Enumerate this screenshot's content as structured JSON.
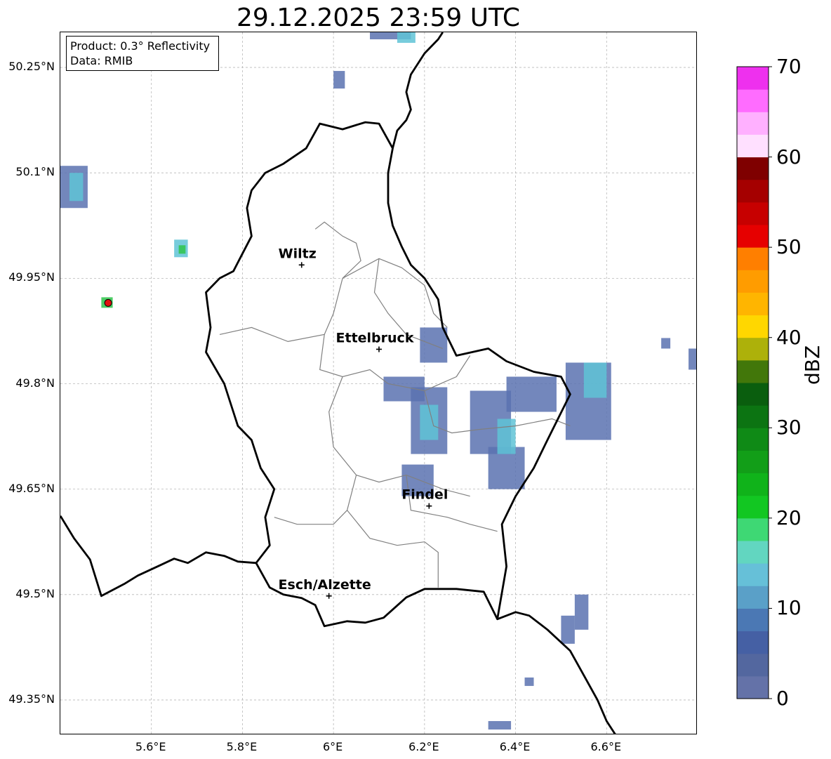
{
  "title": "29.12.2025 23:59 UTC",
  "info_box": {
    "product_line": "Product: 0.3° Reflectivity",
    "data_line": "Data: RMIB"
  },
  "map": {
    "lon_range": [
      5.4,
      6.8
    ],
    "lat_range": [
      49.3,
      50.3
    ],
    "lat_ticks": [
      {
        "value": 50.25,
        "label": "50.25°N"
      },
      {
        "value": 50.1,
        "label": "50.1°N"
      },
      {
        "value": 49.95,
        "label": "49.95°N"
      },
      {
        "value": 49.8,
        "label": "49.8°N"
      },
      {
        "value": 49.65,
        "label": "49.65°N"
      },
      {
        "value": 49.5,
        "label": "49.5°N"
      },
      {
        "value": 49.35,
        "label": "49.35°N"
      }
    ],
    "lon_ticks": [
      {
        "value": 5.6,
        "label": "5.6°E"
      },
      {
        "value": 5.8,
        "label": "5.8°E"
      },
      {
        "value": 6.0,
        "label": "6°E"
      },
      {
        "value": 6.2,
        "label": "6.2°E"
      },
      {
        "value": 6.4,
        "label": "6.4°E"
      },
      {
        "value": 6.6,
        "label": "6.6°E"
      }
    ],
    "cities": [
      {
        "name": "Wiltz",
        "lon": 5.93,
        "lat": 49.969
      },
      {
        "name": "Ettelbruck",
        "lon": 6.1,
        "lat": 49.849
      },
      {
        "name": "Findel",
        "lon": 6.21,
        "lat": 49.626
      },
      {
        "name": "Esch/Alzette",
        "lon": 5.99,
        "lat": 49.498
      }
    ],
    "border": [
      [
        5.4,
        49.612
      ],
      [
        5.43,
        49.58
      ],
      [
        5.465,
        49.55
      ],
      [
        5.49,
        49.498
      ],
      [
        5.54,
        49.515
      ],
      [
        5.57,
        49.527
      ],
      [
        5.62,
        49.542
      ],
      [
        5.65,
        49.551
      ],
      [
        5.68,
        49.545
      ],
      [
        5.72,
        49.56
      ],
      [
        5.76,
        49.555
      ],
      [
        5.79,
        49.547
      ],
      [
        5.83,
        49.545
      ],
      [
        5.86,
        49.51
      ],
      [
        5.89,
        49.5
      ],
      [
        5.93,
        49.495
      ],
      [
        5.96,
        49.485
      ],
      [
        5.98,
        49.455
      ],
      [
        6.03,
        49.462
      ],
      [
        6.07,
        49.46
      ],
      [
        6.11,
        49.467
      ],
      [
        6.16,
        49.496
      ],
      [
        6.2,
        49.508
      ],
      [
        6.27,
        49.508
      ],
      [
        6.33,
        49.504
      ],
      [
        6.36,
        49.465
      ],
      [
        6.4,
        49.475
      ],
      [
        6.43,
        49.47
      ],
      [
        6.47,
        49.45
      ],
      [
        6.52,
        49.42
      ],
      [
        6.55,
        49.385
      ],
      [
        6.58,
        49.35
      ],
      [
        6.6,
        49.32
      ],
      [
        6.62,
        49.3
      ]
    ],
    "border_east": [
      [
        6.36,
        49.465
      ],
      [
        6.38,
        49.54
      ],
      [
        6.37,
        49.6
      ],
      [
        6.4,
        49.64
      ],
      [
        6.44,
        49.68
      ],
      [
        6.47,
        49.72
      ],
      [
        6.52,
        49.785
      ],
      [
        6.5,
        49.81
      ],
      [
        6.44,
        49.817
      ],
      [
        6.38,
        49.832
      ],
      [
        6.34,
        49.85
      ],
      [
        6.27,
        49.84
      ],
      [
        6.24,
        49.88
      ],
      [
        6.23,
        49.92
      ],
      [
        6.2,
        49.95
      ],
      [
        6.17,
        49.969
      ],
      [
        6.15,
        49.995
      ],
      [
        6.13,
        50.025
      ],
      [
        6.12,
        50.057
      ],
      [
        6.12,
        50.1
      ],
      [
        6.13,
        50.135
      ],
      [
        6.14,
        50.16
      ],
      [
        6.16,
        50.175
      ],
      [
        6.17,
        50.19
      ],
      [
        6.16,
        50.215
      ],
      [
        6.17,
        50.24
      ],
      [
        6.2,
        50.27
      ],
      [
        6.23,
        50.29
      ],
      [
        6.24,
        50.3
      ]
    ],
    "border_north": [
      [
        6.13,
        50.135
      ],
      [
        6.1,
        50.17
      ],
      [
        6.07,
        50.172
      ],
      [
        6.02,
        50.162
      ],
      [
        5.97,
        50.17
      ],
      [
        5.94,
        50.135
      ],
      [
        5.89,
        50.113
      ],
      [
        5.85,
        50.1
      ],
      [
        5.82,
        50.075
      ],
      [
        5.81,
        50.05
      ],
      [
        5.82,
        50.01
      ],
      [
        5.8,
        49.985
      ],
      [
        5.78,
        49.96
      ],
      [
        5.75,
        49.95
      ],
      [
        5.72,
        49.93
      ],
      [
        5.73,
        49.88
      ],
      [
        5.72,
        49.845
      ],
      [
        5.76,
        49.8
      ],
      [
        5.79,
        49.74
      ],
      [
        5.82,
        49.72
      ],
      [
        5.84,
        49.68
      ],
      [
        5.87,
        49.65
      ],
      [
        5.85,
        49.61
      ],
      [
        5.86,
        49.57
      ],
      [
        5.83,
        49.545
      ]
    ],
    "cantons": [
      [
        [
          5.96,
          50.02
        ],
        [
          5.98,
          50.03
        ],
        [
          6.02,
          50.01
        ],
        [
          6.05,
          50.0
        ],
        [
          6.06,
          49.975
        ],
        [
          6.02,
          49.95
        ],
        [
          6.0,
          49.9
        ],
        [
          5.98,
          49.87
        ],
        [
          5.9,
          49.86
        ],
        [
          5.82,
          49.88
        ],
        [
          5.75,
          49.87
        ]
      ],
      [
        [
          6.02,
          49.95
        ],
        [
          6.1,
          49.978
        ],
        [
          6.15,
          49.965
        ],
        [
          6.2,
          49.94
        ],
        [
          6.22,
          49.9
        ],
        [
          6.25,
          49.88
        ]
      ],
      [
        [
          6.1,
          49.978
        ],
        [
          6.09,
          49.93
        ],
        [
          6.12,
          49.9
        ],
        [
          6.16,
          49.87
        ],
        [
          6.2,
          49.86
        ],
        [
          6.24,
          49.85
        ]
      ],
      [
        [
          5.98,
          49.87
        ],
        [
          5.97,
          49.82
        ],
        [
          6.02,
          49.81
        ],
        [
          6.08,
          49.82
        ],
        [
          6.12,
          49.8
        ],
        [
          6.2,
          49.79
        ],
        [
          6.27,
          49.81
        ],
        [
          6.3,
          49.84
        ]
      ],
      [
        [
          6.02,
          49.81
        ],
        [
          5.99,
          49.76
        ],
        [
          6.0,
          49.71
        ],
        [
          6.05,
          49.67
        ],
        [
          6.1,
          49.66
        ],
        [
          6.16,
          49.67
        ],
        [
          6.24,
          49.65
        ],
        [
          6.3,
          49.64
        ]
      ],
      [
        [
          6.2,
          49.79
        ],
        [
          6.22,
          49.74
        ],
        [
          6.26,
          49.73
        ],
        [
          6.32,
          49.735
        ],
        [
          6.4,
          49.74
        ],
        [
          6.48,
          49.75
        ],
        [
          6.52,
          49.74
        ]
      ],
      [
        [
          6.05,
          49.67
        ],
        [
          6.03,
          49.62
        ],
        [
          6.0,
          49.6
        ],
        [
          5.92,
          49.6
        ],
        [
          5.87,
          49.61
        ]
      ],
      [
        [
          6.16,
          49.67
        ],
        [
          6.17,
          49.62
        ],
        [
          6.25,
          49.61
        ],
        [
          6.3,
          49.6
        ],
        [
          6.36,
          49.59
        ]
      ],
      [
        [
          6.03,
          49.62
        ],
        [
          6.08,
          49.58
        ],
        [
          6.14,
          49.57
        ],
        [
          6.2,
          49.575
        ],
        [
          6.23,
          49.56
        ],
        [
          6.23,
          49.51
        ]
      ]
    ],
    "radar_echoes": [
      {
        "lon": 5.4,
        "lat": 50.05,
        "w": 0.06,
        "h": 0.06,
        "level": "light"
      },
      {
        "lon": 5.42,
        "lat": 50.06,
        "w": 0.03,
        "h": 0.04,
        "level": "mid"
      },
      {
        "lon": 5.65,
        "lat": 49.98,
        "w": 0.03,
        "h": 0.025,
        "level": "mid"
      },
      {
        "lon": 5.66,
        "lat": 49.985,
        "w": 0.015,
        "h": 0.012,
        "level": "green"
      },
      {
        "lon": 5.49,
        "lat": 49.908,
        "w": 0.025,
        "h": 0.015,
        "level": "green"
      },
      {
        "lon": 6.08,
        "lat": 50.29,
        "w": 0.09,
        "h": 0.02,
        "level": "light"
      },
      {
        "lon": 6.14,
        "lat": 50.285,
        "w": 0.04,
        "h": 0.015,
        "level": "mid"
      },
      {
        "lon": 6.0,
        "lat": 50.22,
        "w": 0.025,
        "h": 0.025,
        "level": "light"
      },
      {
        "lon": 6.19,
        "lat": 49.83,
        "w": 0.06,
        "h": 0.05,
        "level": "light"
      },
      {
        "lon": 6.11,
        "lat": 49.775,
        "w": 0.09,
        "h": 0.035,
        "level": "light"
      },
      {
        "lon": 6.17,
        "lat": 49.7,
        "w": 0.08,
        "h": 0.095,
        "level": "light"
      },
      {
        "lon": 6.19,
        "lat": 49.72,
        "w": 0.04,
        "h": 0.05,
        "level": "mid"
      },
      {
        "lon": 6.15,
        "lat": 49.64,
        "w": 0.07,
        "h": 0.045,
        "level": "light"
      },
      {
        "lon": 6.3,
        "lat": 49.7,
        "w": 0.09,
        "h": 0.09,
        "level": "light"
      },
      {
        "lon": 6.34,
        "lat": 49.65,
        "w": 0.08,
        "h": 0.06,
        "level": "light"
      },
      {
        "lon": 6.36,
        "lat": 49.7,
        "w": 0.04,
        "h": 0.05,
        "level": "mid"
      },
      {
        "lon": 6.38,
        "lat": 49.76,
        "w": 0.11,
        "h": 0.05,
        "level": "light"
      },
      {
        "lon": 6.51,
        "lat": 49.72,
        "w": 0.1,
        "h": 0.11,
        "level": "light"
      },
      {
        "lon": 6.55,
        "lat": 49.78,
        "w": 0.05,
        "h": 0.05,
        "level": "mid"
      },
      {
        "lon": 6.72,
        "lat": 49.85,
        "w": 0.02,
        "h": 0.015,
        "level": "light"
      },
      {
        "lon": 6.78,
        "lat": 49.82,
        "w": 0.02,
        "h": 0.03,
        "level": "light"
      },
      {
        "lon": 6.5,
        "lat": 49.43,
        "w": 0.03,
        "h": 0.04,
        "level": "light"
      },
      {
        "lon": 6.53,
        "lat": 49.45,
        "w": 0.03,
        "h": 0.05,
        "level": "light"
      },
      {
        "lon": 6.34,
        "lat": 49.308,
        "w": 0.05,
        "h": 0.012,
        "level": "light"
      },
      {
        "lon": 6.42,
        "lat": 49.37,
        "w": 0.02,
        "h": 0.012,
        "level": "light"
      }
    ]
  },
  "colorbar": {
    "label": "dBZ",
    "min": 0,
    "max": 70,
    "ticks": [
      {
        "value": 70,
        "label": "70"
      },
      {
        "value": 60,
        "label": "60"
      },
      {
        "value": 50,
        "label": "50"
      },
      {
        "value": 40,
        "label": "40"
      },
      {
        "value": 30,
        "label": "30"
      },
      {
        "value": 20,
        "label": "20"
      },
      {
        "value": 10,
        "label": "10"
      },
      {
        "value": 0,
        "label": "0"
      }
    ],
    "colors": [
      "#6472a8",
      "#53679f",
      "#4560a4",
      "#4b78b4",
      "#5aa0c8",
      "#66c0d8",
      "#62d6c0",
      "#3ed874",
      "#12c722",
      "#10b31a",
      "#129e18",
      "#0f8a16",
      "#0c7412",
      "#0a5e0e",
      "#42770a",
      "#adb10a",
      "#ffd700",
      "#ffb500",
      "#ff9c00",
      "#ff7f00",
      "#e60000",
      "#c70000",
      "#a50000",
      "#7f0000",
      "#ffe0ff",
      "#ffb0ff",
      "#ff6cff",
      "#ee30ee"
    ]
  },
  "echo_colors": {
    "light": "#5a72b0",
    "mid": "#5fc3d6",
    "green": "#2ec44a"
  },
  "marker_color": "#e01010"
}
